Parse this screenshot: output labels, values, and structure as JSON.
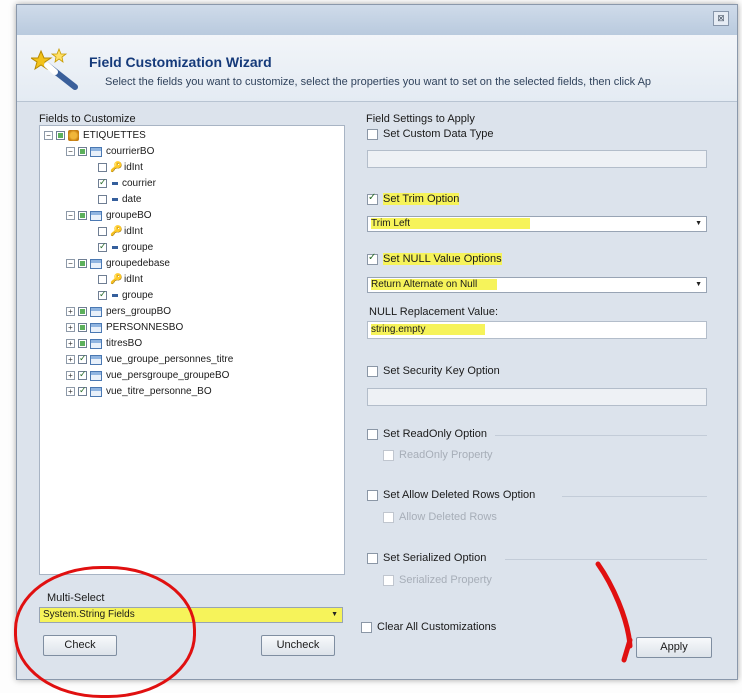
{
  "window": {
    "title": "",
    "close_glyph": "⊠"
  },
  "wizard": {
    "title": "Field Customization Wizard",
    "subtitle": "Select the fields you want to customize, select the properties you want to set on the selected fields, then click Ap"
  },
  "left_panel": {
    "caption": "Fields to Customize",
    "tree": [
      {
        "label": "ETIQUETTES",
        "level": 0,
        "icon": "database-icon",
        "check": "partial",
        "expander": "−"
      },
      {
        "label": "courrierBO",
        "level": 1,
        "icon": "table-icon",
        "check": "partial",
        "expander": "−"
      },
      {
        "label": "idInt",
        "level": 2,
        "icon": "key-icon",
        "check": "none"
      },
      {
        "label": "courrier",
        "level": 2,
        "icon": "field-icon",
        "check": "checked"
      },
      {
        "label": "date",
        "level": 2,
        "icon": "field-icon",
        "check": "none"
      },
      {
        "label": "groupeBO",
        "level": 1,
        "icon": "table-icon",
        "check": "partial",
        "expander": "−"
      },
      {
        "label": "idInt",
        "level": 2,
        "icon": "key-icon",
        "check": "none"
      },
      {
        "label": "groupe",
        "level": 2,
        "icon": "field-icon",
        "check": "checked"
      },
      {
        "label": "groupedebase",
        "level": 1,
        "icon": "table-icon",
        "check": "partial",
        "expander": "−"
      },
      {
        "label": "idInt",
        "level": 2,
        "icon": "key-icon",
        "check": "none"
      },
      {
        "label": "groupe",
        "level": 2,
        "icon": "field-icon",
        "check": "checked"
      },
      {
        "label": "pers_groupBO",
        "level": 1,
        "icon": "table-icon",
        "check": "partial",
        "expander": "+"
      },
      {
        "label": "PERSONNESBO",
        "level": 1,
        "icon": "table-icon",
        "check": "partial",
        "expander": "+"
      },
      {
        "label": "titresBO",
        "level": 1,
        "icon": "table-icon",
        "check": "partial",
        "expander": "+"
      },
      {
        "label": "vue_groupe_personnes_titre",
        "level": 1,
        "icon": "table-icon",
        "check": "checked",
        "expander": "+"
      },
      {
        "label": "vue_persgroupe_groupeBO",
        "level": 1,
        "icon": "table-icon",
        "check": "checked",
        "expander": "+"
      },
      {
        "label": "vue_titre_personne_BO",
        "level": 1,
        "icon": "table-icon",
        "check": "checked",
        "expander": "+"
      }
    ],
    "multi_select_label": "Multi-Select",
    "multi_select_value": "System.String Fields",
    "check_button": "Check",
    "uncheck_button": "Uncheck"
  },
  "right_panel": {
    "caption": "Field Settings to Apply",
    "custom_data_type": {
      "label": "Set Custom Data Type",
      "checked": false,
      "value": ""
    },
    "trim": {
      "label": "Set Trim Option",
      "checked": true,
      "value": "Trim Left"
    },
    "null_value": {
      "label": "Set NULL Value Options",
      "checked": true,
      "value": "Return Alternate on Null"
    },
    "null_replacement_label": "NULL Replacement Value:",
    "null_replacement_value": "string.empty",
    "security_key": {
      "label": "Set Security Key Option",
      "checked": false,
      "value": ""
    },
    "readonly": {
      "label": "Set ReadOnly Option",
      "checked": false,
      "sub_label": "ReadOnly Property"
    },
    "allow_deleted": {
      "label": "Set Allow Deleted Rows Option",
      "checked": false,
      "sub_label": "Allow Deleted Rows"
    },
    "serialized": {
      "label": "Set Serialized Option",
      "checked": false,
      "sub_label": "Serialized Property"
    },
    "clear_all": {
      "label": "Clear All Customizations",
      "checked": false
    },
    "apply_button": "Apply"
  },
  "colors": {
    "highlight": "#f6f35a",
    "annotation": "#e01010",
    "title": "#153a7a"
  }
}
